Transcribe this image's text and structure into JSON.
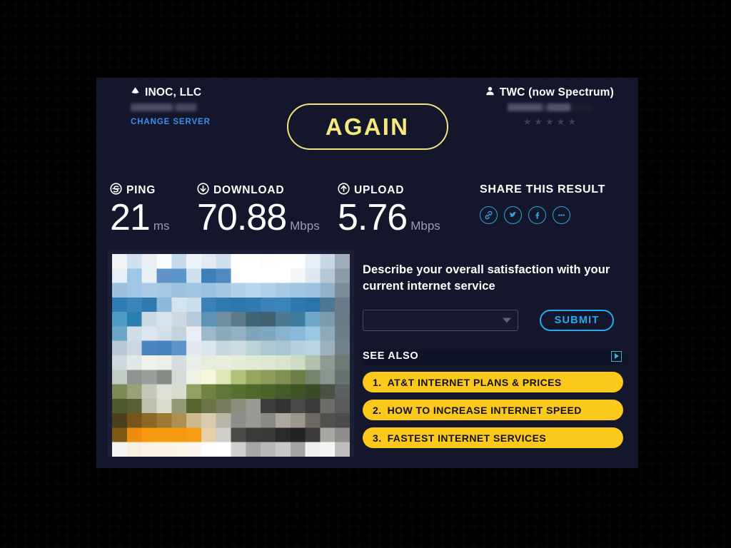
{
  "background": {
    "pattern": "plus-grid",
    "color": "#050505",
    "mark_color": "#aaaaaa"
  },
  "card": {
    "bg": "#14172b"
  },
  "header": {
    "server": {
      "icon": "server-diamond-icon",
      "name": "INOC, LLC",
      "location_redacted": true,
      "change_server_label": "CHANGE SERVER"
    },
    "isp": {
      "icon": "person-icon",
      "name": "TWC (now Spectrum)",
      "details_redacted": true,
      "rating_stars": 5,
      "star_glyph": "★"
    },
    "again_button": {
      "label": "AGAIN",
      "accent": "#f3e37c"
    }
  },
  "results": {
    "ping": {
      "icon": "ping-icon",
      "label": "PING",
      "value": "21",
      "unit": "ms"
    },
    "download": {
      "icon": "download-arrow-icon",
      "label": "DOWNLOAD",
      "value": "70.88",
      "unit": "Mbps"
    },
    "upload": {
      "icon": "upload-arrow-icon",
      "label": "UPLOAD",
      "value": "5.76",
      "unit": "Mbps"
    },
    "share": {
      "title": "SHARE THIS RESULT",
      "accent": "#2fa4e0",
      "icons": [
        {
          "name": "link-icon"
        },
        {
          "name": "twitter-icon"
        },
        {
          "name": "facebook-icon"
        },
        {
          "name": "more-options-icon"
        }
      ]
    }
  },
  "survey": {
    "question": "Describe your overall satisfaction with your current internet service",
    "select_value": "",
    "select_placeholder": "",
    "submit_label": "SUBMIT",
    "accent": "#29a8ee"
  },
  "see_also": {
    "title": "SEE ALSO",
    "adchoices_icon": "adchoices-icon",
    "accent": "#fbc91b",
    "items": [
      {
        "num": "1.",
        "label": "AT&T INTERNET PLANS & PRICES"
      },
      {
        "num": "2.",
        "label": "HOW TO INCREASE INTERNET SPEED"
      },
      {
        "num": "3.",
        "label": "FASTEST INTERNET SERVICES"
      }
    ]
  },
  "ad_image": {
    "name": "pixelated-ad-image",
    "description_redacted": true
  }
}
